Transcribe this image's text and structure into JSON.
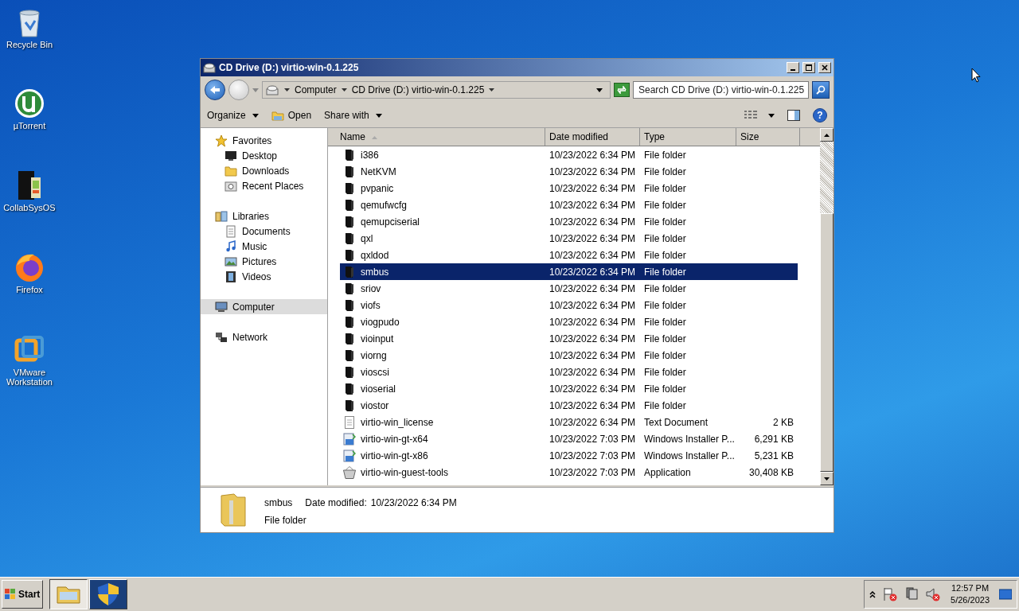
{
  "desktop_icons": [
    {
      "label": "Recycle Bin",
      "kind": "bin"
    },
    {
      "label": "µTorrent",
      "kind": "torrent"
    },
    {
      "label": "CollabSysOS",
      "kind": "collab"
    },
    {
      "label": "Firefox",
      "kind": "firefox"
    },
    {
      "label": "VMware Workstation",
      "kind": "vmware"
    }
  ],
  "window": {
    "title": "CD Drive (D:) virtio-win-0.1.225",
    "address": [
      "Computer",
      "CD Drive (D:) virtio-win-0.1.225"
    ],
    "help_label": "?",
    "search": {
      "placeholder": "Search CD Drive (D:) virtio-win-0.1.225"
    },
    "toolbar": [
      {
        "label": "Organize",
        "dropdown": true,
        "kind": "text"
      },
      {
        "label": "Open",
        "dropdown": false,
        "kind": "open"
      },
      {
        "label": "Share with",
        "dropdown": true,
        "kind": "text"
      }
    ],
    "nav": [
      {
        "label": "Favorites",
        "kind": "star",
        "selected": false,
        "children": [
          {
            "label": "Desktop",
            "kind": "desktop",
            "selected": false
          },
          {
            "label": "Downloads",
            "kind": "folder",
            "selected": false
          },
          {
            "label": "Recent Places",
            "kind": "recent",
            "selected": false
          }
        ]
      },
      {
        "label": "Libraries",
        "kind": "library",
        "selected": false,
        "children": [
          {
            "label": "Documents",
            "kind": "doc",
            "selected": false
          },
          {
            "label": "Music",
            "kind": "music",
            "selected": false
          },
          {
            "label": "Pictures",
            "kind": "picture",
            "selected": false
          },
          {
            "label": "Videos",
            "kind": "video",
            "selected": false
          }
        ]
      },
      {
        "label": "Computer",
        "kind": "computer",
        "selected": true
      },
      {
        "label": "Network",
        "kind": "network",
        "selected": false
      }
    ],
    "columns": [
      "Name",
      "Date modified",
      "Type",
      "Size"
    ],
    "rows": [
      {
        "name": "i386",
        "date": "10/23/2022 6:34 PM",
        "type": "File folder",
        "kind": "folder",
        "selected": false
      },
      {
        "name": "NetKVM",
        "date": "10/23/2022 6:34 PM",
        "type": "File folder",
        "kind": "folder",
        "selected": false
      },
      {
        "name": "pvpanic",
        "date": "10/23/2022 6:34 PM",
        "type": "File folder",
        "kind": "folder",
        "selected": false
      },
      {
        "name": "qemufwcfg",
        "date": "10/23/2022 6:34 PM",
        "type": "File folder",
        "kind": "folder",
        "selected": false
      },
      {
        "name": "qemupciserial",
        "date": "10/23/2022 6:34 PM",
        "type": "File folder",
        "kind": "folder",
        "selected": false
      },
      {
        "name": "qxl",
        "date": "10/23/2022 6:34 PM",
        "type": "File folder",
        "kind": "folder",
        "selected": false
      },
      {
        "name": "qxldod",
        "date": "10/23/2022 6:34 PM",
        "type": "File folder",
        "kind": "folder",
        "selected": false
      },
      {
        "name": "smbus",
        "date": "10/23/2022 6:34 PM",
        "type": "File folder",
        "kind": "folder",
        "selected": true
      },
      {
        "name": "sriov",
        "date": "10/23/2022 6:34 PM",
        "type": "File folder",
        "kind": "folder",
        "selected": false
      },
      {
        "name": "viofs",
        "date": "10/23/2022 6:34 PM",
        "type": "File folder",
        "kind": "folder",
        "selected": false
      },
      {
        "name": "viogpudo",
        "date": "10/23/2022 6:34 PM",
        "type": "File folder",
        "kind": "folder",
        "selected": false
      },
      {
        "name": "vioinput",
        "date": "10/23/2022 6:34 PM",
        "type": "File folder",
        "kind": "folder",
        "selected": false
      },
      {
        "name": "viorng",
        "date": "10/23/2022 6:34 PM",
        "type": "File folder",
        "kind": "folder",
        "selected": false
      },
      {
        "name": "vioscsi",
        "date": "10/23/2022 6:34 PM",
        "type": "File folder",
        "kind": "folder",
        "selected": false
      },
      {
        "name": "vioserial",
        "date": "10/23/2022 6:34 PM",
        "type": "File folder",
        "kind": "folder",
        "selected": false
      },
      {
        "name": "viostor",
        "date": "10/23/2022 6:34 PM",
        "type": "File folder",
        "kind": "folder",
        "selected": false
      },
      {
        "name": "virtio-win_license",
        "date": "10/23/2022 6:34 PM",
        "type": "Text Document",
        "size": "2 KB",
        "kind": "text",
        "selected": false
      },
      {
        "name": "virtio-win-gt-x64",
        "date": "10/23/2022 7:03 PM",
        "type": "Windows Installer P...",
        "size": "6,291 KB",
        "kind": "installer",
        "selected": false
      },
      {
        "name": "virtio-win-gt-x86",
        "date": "10/23/2022 7:03 PM",
        "type": "Windows Installer P...",
        "size": "5,231 KB",
        "kind": "installer",
        "selected": false
      },
      {
        "name": "virtio-win-guest-tools",
        "date": "10/23/2022 7:03 PM",
        "type": "Application",
        "size": "30,408 KB",
        "kind": "app",
        "selected": false
      }
    ],
    "details": {
      "name": "smbus",
      "date_label": "Date modified:",
      "date": "10/23/2022 6:34 PM",
      "type": "File folder"
    }
  },
  "taskbar": {
    "start": "Start",
    "apps": [
      {
        "kind": "explorer",
        "selected": true
      },
      {
        "kind": "shield",
        "selected": false
      }
    ],
    "time": "12:57 PM",
    "date": "5/26/2023"
  }
}
